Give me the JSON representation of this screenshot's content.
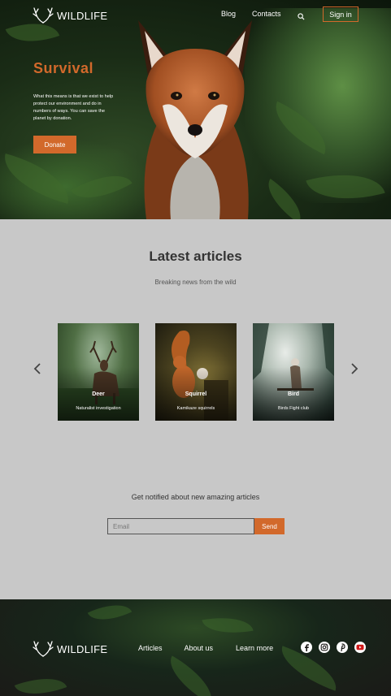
{
  "brand": {
    "name": "WILDLIFE",
    "accent": "#d2692b"
  },
  "nav": {
    "items": [
      {
        "label": "Blog"
      },
      {
        "label": "Contacts"
      }
    ],
    "search_icon": "search-icon",
    "signin_label": "Sign in"
  },
  "hero": {
    "title": "Survival",
    "description": "What this means is that we exist to help protect our environment and do in numbers of ways. You can save the planet by donation.",
    "donate_label": "Donate"
  },
  "articles": {
    "title": "Latest articles",
    "subtitle": "Breaking news from the wild",
    "prev_icon": "chevron-left-icon",
    "next_icon": "chevron-right-icon",
    "cards": [
      {
        "title": "Deer",
        "subtitle": "Naturalist investigation"
      },
      {
        "title": "Squirrel",
        "subtitle": "Kamikaze squirrels"
      },
      {
        "title": "Bird",
        "subtitle": "Birds Fight club"
      }
    ]
  },
  "newsletter": {
    "heading": "Get notified about new amazing articles",
    "email_placeholder": "Email",
    "send_label": "Send"
  },
  "footer": {
    "links": [
      {
        "label": "Articles"
      },
      {
        "label": "About us"
      },
      {
        "label": "Learn more"
      }
    ],
    "social_icons": [
      "facebook-icon",
      "instagram-icon",
      "pinterest-icon",
      "youtube-icon"
    ]
  }
}
